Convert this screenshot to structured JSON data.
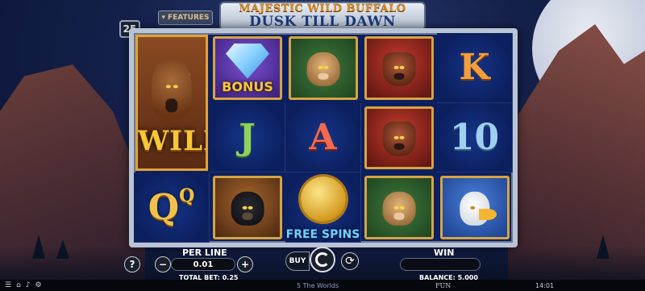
{
  "game": {
    "title_line1": "MAJESTIC WILD BUFFALO",
    "title_line2": "DUSK TILL DAWN",
    "features_label": "FEATURES",
    "lines_count": "25"
  },
  "reels": {
    "wild_label": "WILD",
    "bonus_label": "BONUS",
    "free_spins_label": "FREE SPINS",
    "letters": {
      "k": "K",
      "ten": "10",
      "j": "J",
      "a": "A",
      "q": "Q",
      "q_small": "Q"
    },
    "symbols": [
      [
        "bison-wild",
        "diamond-bonus",
        "cougar-cubs",
        "wolf",
        "K"
      ],
      [
        "bison-wild",
        "J",
        "A",
        "wolf-pack",
        "10"
      ],
      [
        "Q",
        "bear",
        "free-spins",
        "cougar",
        "eagle"
      ]
    ]
  },
  "controls": {
    "help_label": "?",
    "minus_label": "−",
    "plus_label": "+",
    "per_line_label": "PER LINE",
    "per_line_value": "0.01",
    "total_bet_text": "TOTAL BET: 0.25",
    "buy_label": "BUY",
    "win_label": "WIN",
    "win_value": "",
    "balance_text": "BALANCE: 5.000"
  },
  "footer": {
    "icons": [
      "menu-icon",
      "home-icon",
      "sound-icon",
      "paytable-icon"
    ],
    "brand": "5 The Worlds",
    "mode": "FUN",
    "time": "14:01"
  },
  "colors": {
    "frame_border": "#b9c4d6",
    "reel_bg": "#0c1f5e",
    "gold": "#f6c636",
    "accent_blue": "#6fd0ff"
  }
}
